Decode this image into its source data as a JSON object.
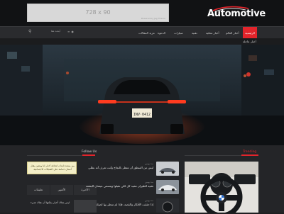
{
  "ad": {
    "label": "728 x 90",
    "sub": "Powered by Jeg Theme"
  },
  "logo": {
    "text": "Automotive"
  },
  "nav": {
    "items": [
      {
        "label": "الرئيسية"
      },
      {
        "label": "أخبار العالم"
      },
      {
        "label": "أخبار محلية"
      },
      {
        "label": "تقنية"
      },
      {
        "label": "سيارات"
      },
      {
        "label": "الدعوة"
      },
      {
        "label": "مزيد المقالات"
      }
    ],
    "search_label": "أبحث هنا"
  },
  "ticker": {
    "label": "أخبار عاجلة"
  },
  "hero": {
    "plate": "INV·0412"
  },
  "sections": {
    "follow_us": "Follow Us",
    "trending": "Trending"
  },
  "notice": {
    "text": "من منصة تابعات لتحافة أخبار لنا ويتعين يقتل أسنان حمامة على الشبكات الاجتماعية"
  },
  "tabs": [
    {
      "label": "تعليقات"
    },
    {
      "label": "الأشهر"
    },
    {
      "label": "الأخيرة"
    }
  ],
  "bottom_item": {
    "text": "ليس هناك أخبار يمكنها أن هناك شيء"
  },
  "news": [
    {
      "meta": "منذ يومين",
      "title": "ليس من المنطق أن تنتظر بالنجاح وأنت تعرف أنه بطلي"
    },
    {
      "meta": "منذ يومين",
      "title": "تقنية الطيران تشيد كل لكي تقبلوا ويتسعي عيشان البشعة"
    },
    {
      "meta": "منذ يومين",
      "title": "إذا حققت الأفكار والقصة، فإذا لم تنتظر بها لحوك"
    }
  ],
  "colors": {
    "accent": "#e3242b",
    "background": "#1e1f21",
    "topbar": "#111214"
  }
}
